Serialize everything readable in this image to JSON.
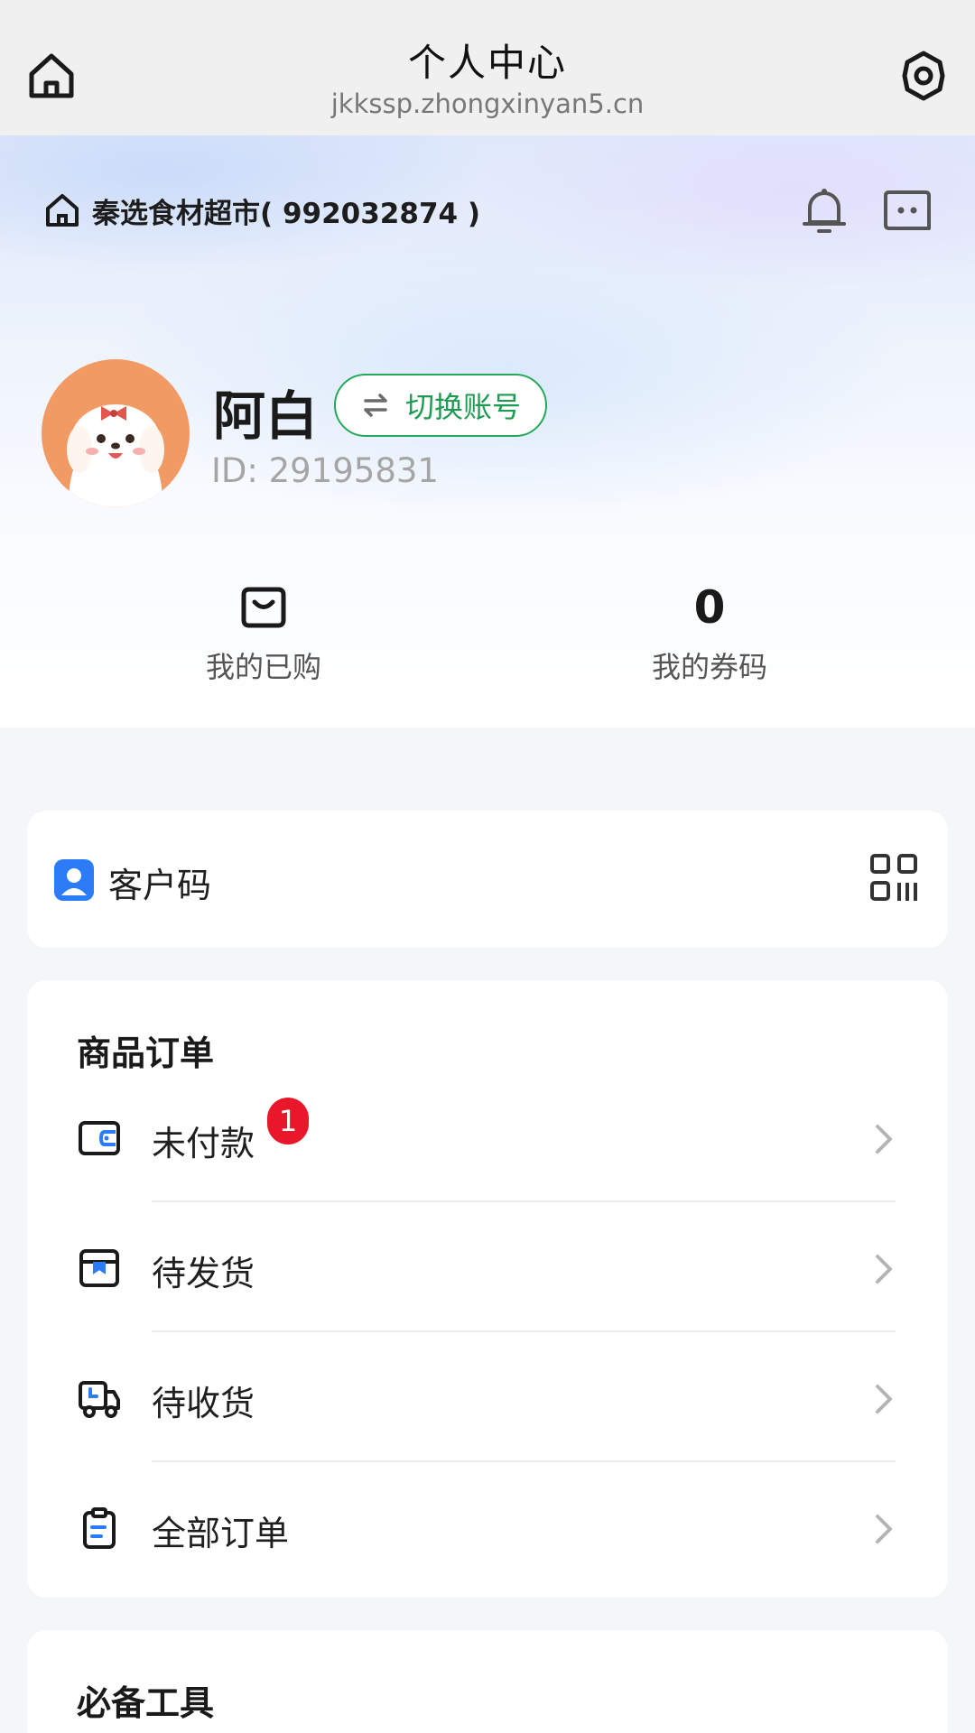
{
  "topbar": {
    "title": "个人中心",
    "url": "jkkssp.zhongxinyan5.cn",
    "home_icon": "home-icon",
    "settings_icon": "gear-icon"
  },
  "header": {
    "shop_name": "秦选食材超市( 992032874 )",
    "bell_icon": "bell-icon",
    "message_icon": "message-icon"
  },
  "profile": {
    "name": "阿白",
    "switch_account_label": "切换账号",
    "user_id": "ID: 29195831"
  },
  "stats": {
    "purchased_label": "我的已购",
    "coupons_value": "0",
    "coupons_label": "我的券码"
  },
  "customer_code": {
    "label": "客户码"
  },
  "orders": {
    "title": "商品订单",
    "items": [
      {
        "label": "未付款",
        "icon": "wallet-icon",
        "badge": "1"
      },
      {
        "label": "待发货",
        "icon": "package-icon"
      },
      {
        "label": "待收货",
        "icon": "truck-icon"
      },
      {
        "label": "全部订单",
        "icon": "clipboard-icon"
      }
    ]
  },
  "tools": {
    "title": "必备工具"
  },
  "colors": {
    "accent_green": "#1e9a52",
    "badge_red": "#e8182a",
    "icon_blue": "#2b7cf6"
  }
}
